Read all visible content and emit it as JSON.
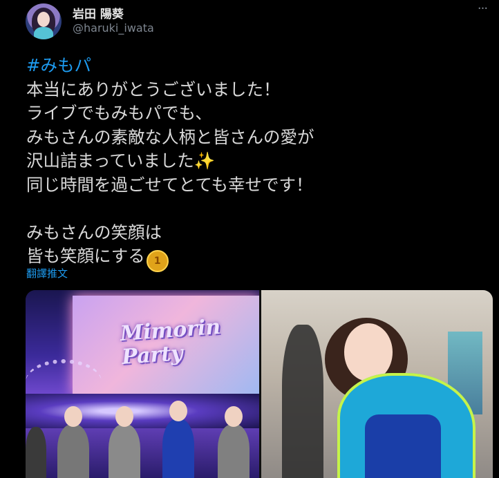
{
  "author": {
    "display_name": "岩田 陽葵",
    "handle": "@haruki_iwata"
  },
  "menu": {
    "more_label": "···"
  },
  "tweet": {
    "hashtag": "#みもパ",
    "lines": [
      "本当にありがとうございました！",
      "ライブでもみもパでも、",
      "みもさんの素敵な人柄と皆さんの愛が",
      "沢山詰まっていました",
      "同じ時間を過ごせてとても幸せです！",
      "",
      "みもさんの笑顔は",
      "皆も笑顔にする"
    ],
    "emoji_sparkle": "✨",
    "emoji_medal": "1"
  },
  "translate_label": "翻譯推文",
  "media": {
    "left_screen_text": "Mimorin Party"
  },
  "colors": {
    "background": "#000000",
    "text": "#d9d9d9",
    "link": "#1d9bf0",
    "muted": "#7e8690"
  }
}
